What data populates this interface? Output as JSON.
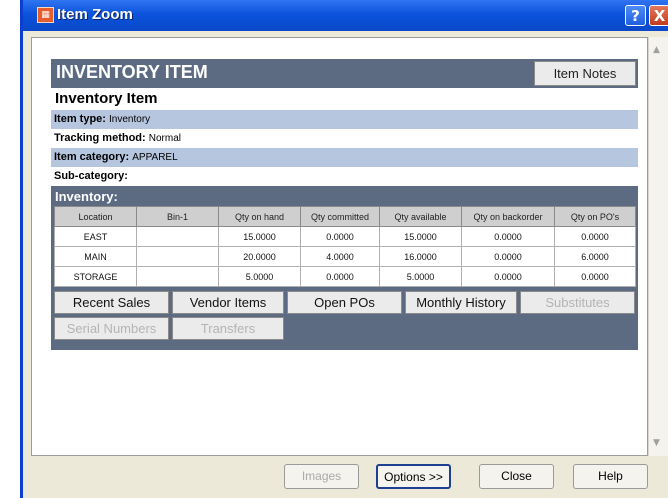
{
  "window": {
    "title": "Item Zoom",
    "help_label": "?",
    "close_label": "X"
  },
  "header": {
    "title": "INVENTORY ITEM",
    "notes_label": "Item Notes"
  },
  "section_title": "Inventory Item",
  "info": {
    "item_type_label": "Item type:",
    "item_type_value": "Inventory",
    "tracking_label": "Tracking method:",
    "tracking_value": "Normal",
    "category_label": "Item category:",
    "category_value": "APPAREL",
    "subcategory_label": "Sub-category:",
    "subcategory_value": ""
  },
  "inventory": {
    "label": "Inventory:",
    "columns": [
      "Location",
      "Bin-1",
      "Qty on hand",
      "Qty committed",
      "Qty available",
      "Qty on backorder",
      "Qty on PO's"
    ],
    "rows": [
      [
        "EAST",
        "",
        "15.0000",
        "0.0000",
        "15.0000",
        "0.0000",
        "0.0000"
      ],
      [
        "MAIN",
        "",
        "20.0000",
        "4.0000",
        "16.0000",
        "0.0000",
        "6.0000"
      ],
      [
        "STORAGE",
        "",
        "5.0000",
        "0.0000",
        "5.0000",
        "0.0000",
        "0.0000"
      ]
    ]
  },
  "actions": {
    "recent_sales": "Recent Sales",
    "vendor_items": "Vendor Items",
    "open_pos": "Open POs",
    "monthly_history": "Monthly History",
    "substitutes": "Substitutes",
    "serial_numbers": "Serial Numbers",
    "transfers": "Transfers"
  },
  "footer": {
    "images": "Images",
    "options": "Options >>",
    "close": "Close",
    "help": "Help"
  },
  "colors": {
    "header_bg": "#5d6b82",
    "row_shade": "#b7c6df",
    "titlebar": "#0b53dd"
  }
}
